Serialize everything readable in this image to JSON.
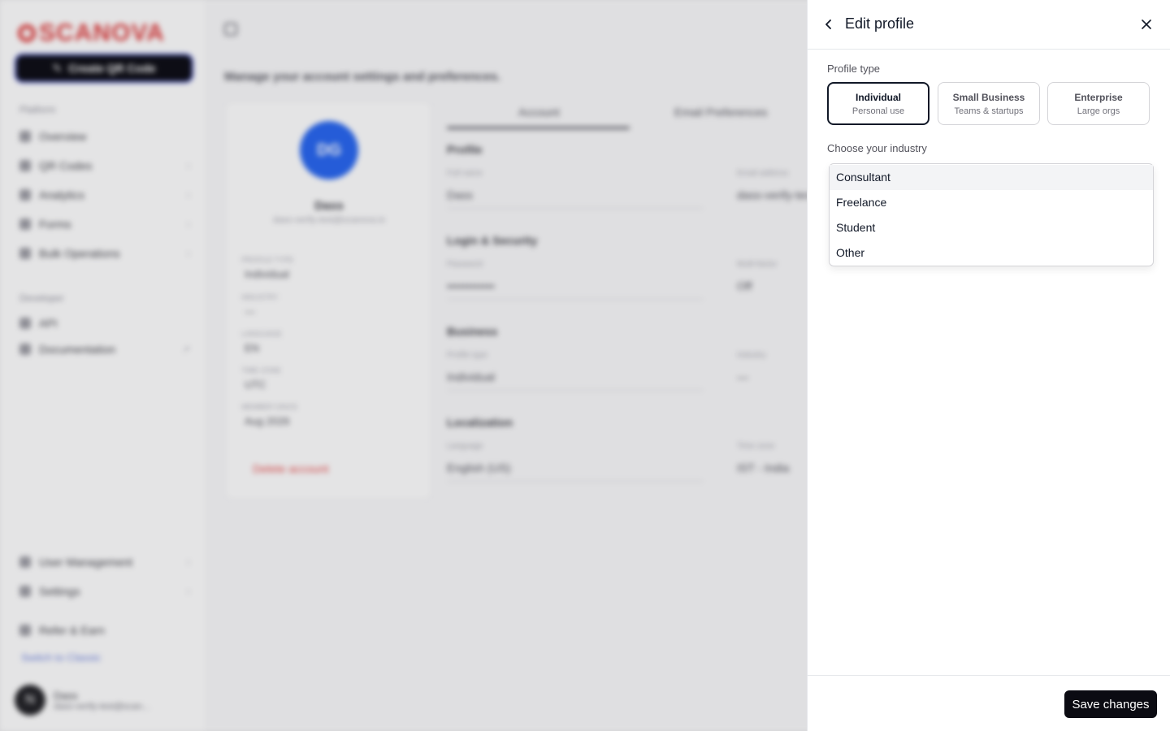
{
  "background": {
    "brand": "SCANOVA",
    "create_button": "Create QR Code",
    "nav_platform_label": "Platform",
    "nav_platform": [
      "Overview",
      "QR Codes",
      "Analytics",
      "Forms",
      "Bulk Operations"
    ],
    "nav_developer_label": "Developer",
    "nav_developer": [
      "API",
      "Documentation"
    ],
    "nav_bottom": [
      "User Management",
      "Settings",
      "Refer & Earn"
    ],
    "switch_link": "Switch to Classic",
    "user": {
      "initial": "N",
      "name": "Dass",
      "email": "dass-verify-test@scan..."
    },
    "page_subtitle": "Manage your account settings and preferences.",
    "profile_card": {
      "initials": "DG",
      "name": "Dass",
      "email": "dass-verify-test@scanova.io",
      "labels": [
        "Profile type",
        "Industry",
        "Language",
        "Time zone",
        "Member since"
      ],
      "values": [
        "Individual",
        "—",
        "EN",
        "UTC",
        "Aug 2026"
      ],
      "delete": "Delete account"
    },
    "tabs": [
      "Account",
      "Email Preferences"
    ],
    "sections": {
      "profile": "Profile",
      "login": "Login & Security",
      "business": "Business",
      "localization": "Localization"
    },
    "fields": {
      "full_name_label": "Full name",
      "full_name": "Dass",
      "email_label": "Email address",
      "email": "dass-verify-test",
      "password_label": "Password",
      "password": "••••••••••••",
      "mfa_label": "Multi-factor",
      "mfa": "Off",
      "profile_type_label": "Profile type",
      "profile_type": "Individual",
      "industry_label": "Industry",
      "industry": "—",
      "language_label": "Language",
      "language": "English (US)",
      "timezone_label": "Time zone",
      "timezone": "IST - India"
    }
  },
  "drawer": {
    "title": "Edit profile",
    "profile_type_label": "Profile type",
    "profile_types": [
      {
        "title": "Individual",
        "subtitle": "Personal use",
        "selected": true
      },
      {
        "title": "Small Business",
        "subtitle": "Teams & startups",
        "selected": false
      },
      {
        "title": "Enterprise",
        "subtitle": "Large orgs",
        "selected": false
      }
    ],
    "industry_label": "Choose your industry",
    "industry_options": [
      "Consultant",
      "Freelance",
      "Student",
      "Other"
    ],
    "hovered_option": "Consultant",
    "save_label": "Save changes"
  },
  "colors": {
    "primary": "#0b0b12",
    "brand": "#d93a3a",
    "selected_border": "#111827",
    "hover_bg": "#f3f4f6"
  }
}
